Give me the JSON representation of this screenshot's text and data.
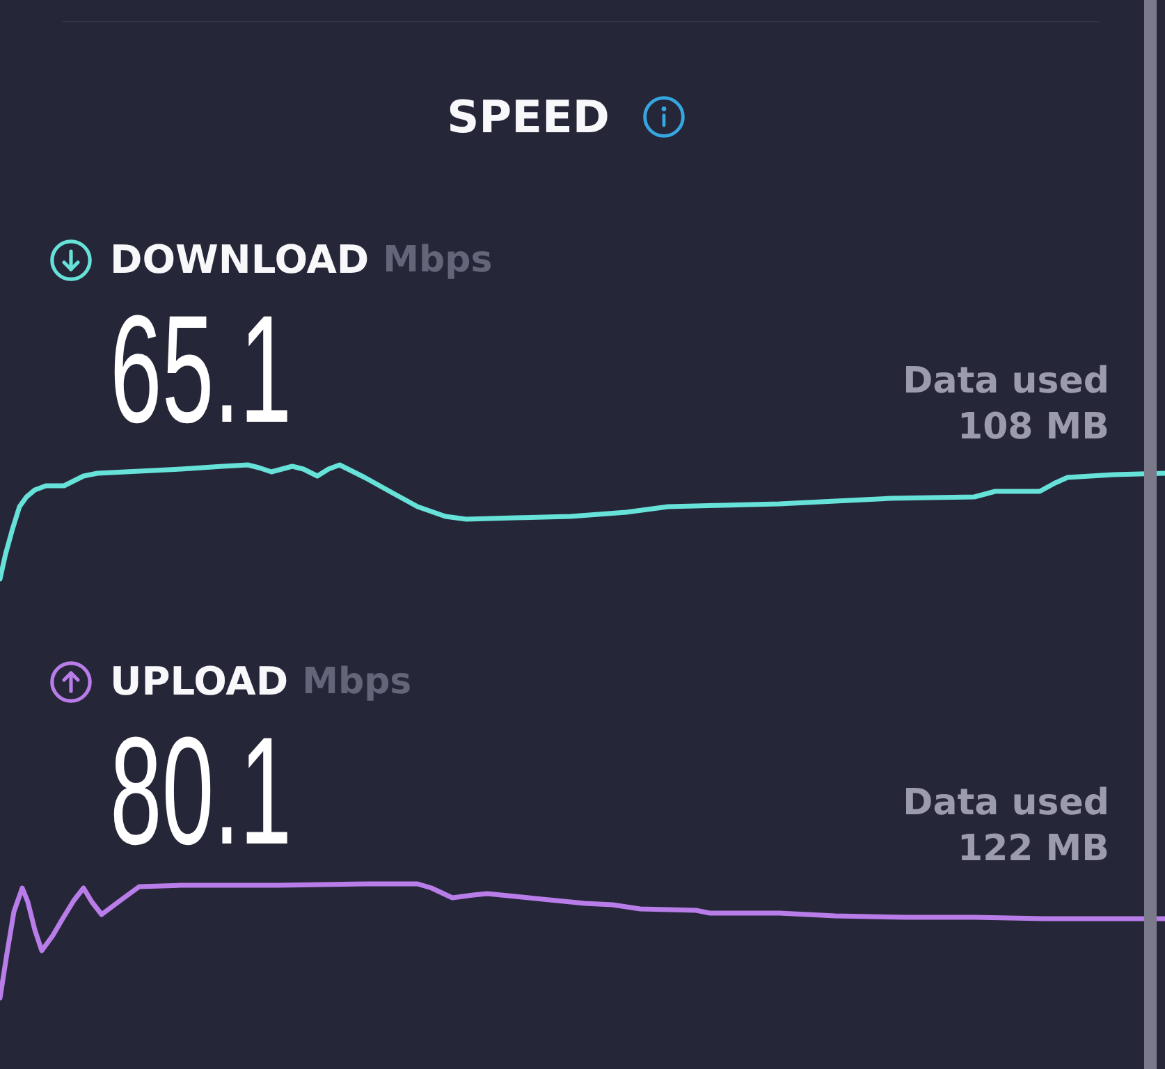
{
  "header": {
    "title": "SPEED"
  },
  "tests": [
    {
      "kind": "download",
      "color": "#66e2d9",
      "label": "DOWNLOAD",
      "unit": "Mbps",
      "value": "65.1",
      "data_used_label": "Data used",
      "data_used": "108 MB"
    },
    {
      "kind": "upload",
      "color": "#b97de9",
      "label": "UPLOAD",
      "unit": "Mbps",
      "value": "80.1",
      "data_used_label": "Data used",
      "data_used": "122 MB"
    }
  ]
}
